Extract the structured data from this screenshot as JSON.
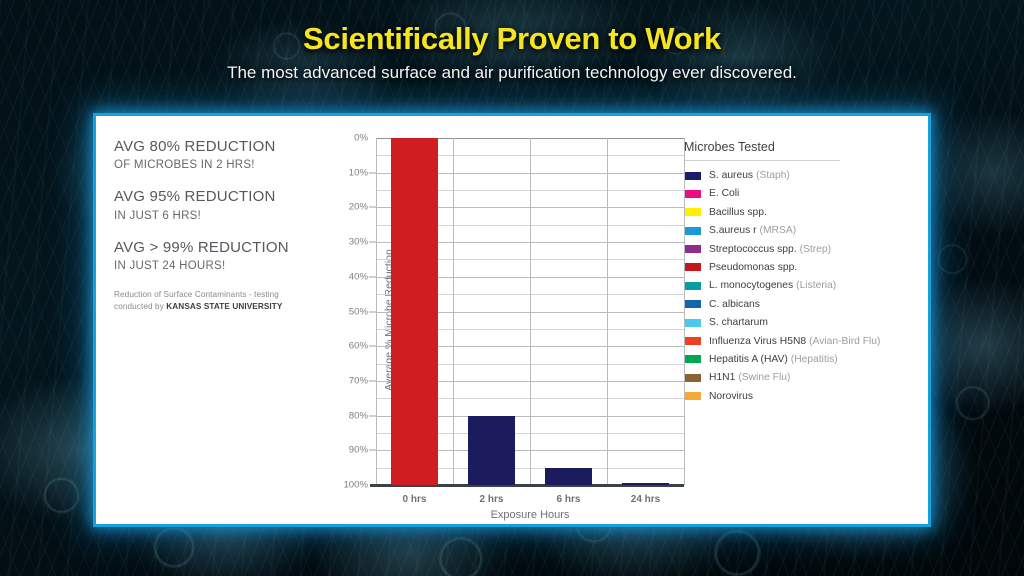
{
  "header": {
    "title": "Scientifically Proven to Work",
    "subtitle": "The most advanced surface and air purification technology ever discovered.",
    "title_color": "#F5E420"
  },
  "left_panel": {
    "stats": [
      {
        "headline": "AVG 80% REDUCTION",
        "sub": "OF MICROBES IN 2 HRS!"
      },
      {
        "headline": "AVG 95% REDUCTION",
        "sub": "IN JUST 6 HRS!"
      },
      {
        "headline": "AVG > 99% REDUCTION",
        "sub": "IN JUST 24 HOURS!"
      }
    ],
    "attribution_pre": "Reduction of Surface Contaminants - testing conducted by ",
    "attribution_bold": "KANSAS STATE UNIVERSITY"
  },
  "legend": {
    "title": "Microbes Tested",
    "items": [
      {
        "name": "S. aureus",
        "alias": "(Staph)",
        "color": "#1B1B6E"
      },
      {
        "name": "E. Coli",
        "alias": "",
        "color": "#EC0E7E"
      },
      {
        "name": "Bacillus spp.",
        "alias": "",
        "color": "#FFF000"
      },
      {
        "name": "S.aureus r",
        "alias": "(MRSA)",
        "color": "#1C9AD6"
      },
      {
        "name": "Streptococcus spp.",
        "alias": "(Strep)",
        "color": "#8E2D8E"
      },
      {
        "name": "Pseudomonas spp.",
        "alias": "",
        "color": "#C4161C"
      },
      {
        "name": "L. monocytogenes",
        "alias": "(Listeria)",
        "color": "#089C9C"
      },
      {
        "name": "C. albicans",
        "alias": "",
        "color": "#1266B0"
      },
      {
        "name": "S. chartarum",
        "alias": "",
        "color": "#4CC8ED"
      },
      {
        "name": "Influenza Virus H5N8",
        "alias": "(Avian-Bird Flu)",
        "color": "#EE4323"
      },
      {
        "name": "Hepatitis A (HAV)",
        "alias": "(Hepatitis)",
        "color": "#00A651"
      },
      {
        "name": "H1N1",
        "alias": "(Swine Flu)",
        "color": "#8B6332"
      },
      {
        "name": "Norovirus",
        "alias": "",
        "color": "#F7A938"
      }
    ]
  },
  "chart_data": {
    "type": "bar",
    "title": "",
    "xlabel": "Exposure Hours",
    "ylabel": "Average % Microbe Reduction",
    "categories": [
      "0 hrs",
      "2 hrs",
      "6 hrs",
      "24 hrs"
    ],
    "values": [
      0,
      80,
      95,
      99.5
    ],
    "bar_colors": [
      "#CE1E21",
      "#1B1B5E",
      "#1B1B5E",
      "#1B1B5E"
    ],
    "ylim": [
      0,
      100
    ],
    "y_inverted": true,
    "ytick_labels": [
      "0%",
      "10%",
      "20%",
      "30%",
      "40%",
      "50%",
      "60%",
      "70%",
      "80%",
      "90%",
      "100%"
    ],
    "ytick_values": [
      0,
      10,
      20,
      30,
      40,
      50,
      60,
      70,
      80,
      90,
      100
    ],
    "minor_gridline_step": 5,
    "grid": true,
    "legend_position": "right"
  }
}
